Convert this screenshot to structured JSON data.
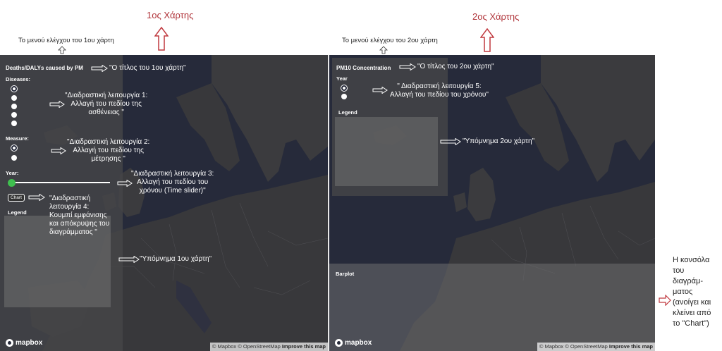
{
  "top": {
    "map1_heading": "1ος Χάρτης",
    "map2_heading": "2ος Χάρτης",
    "map1_menu_note": "Το μενού ελέγχου του 1ου χάρτη",
    "map2_menu_note": "Το μενού ελέγχου του 2ου χάρτη"
  },
  "map1": {
    "title": "Deaths/DALYs caused by PM",
    "diseases_label": "Diseases:",
    "measure_label": "Measure:",
    "year_label": "Year:",
    "chart_button": "Chart",
    "legend_label": "Legend",
    "year_slider_fraction": 0.0,
    "annotations": {
      "title_note": "\"Ο τίτλος του 1ου χάρτη\"",
      "feature1": "\"Διαδραστική λειτουργία 1:\nΑλλαγή του πεδίου της\nασθένειας \"",
      "feature2": "\"Διαδραστική λειτουργία 2:\nΑλλαγή του πεδίου της\nμέτρησης \"",
      "feature3": "\"Διαδραστική λειτουργία 3:\nΑλλαγή του πεδίου του\nχρόνου (Time slider)\"",
      "feature4": "\"Διαδραστική\nλειτουργία 4:\nΚουμπί εμφάνισης\nκαι απόκρυψης του\nδιαγράμματος \"",
      "legend_note": "\"Υπόμνημα 1ου χάρτη\""
    }
  },
  "map2": {
    "title": "PM10 Concentration",
    "year_label": "Year",
    "legend_label": "Legend",
    "barplot_label": "Barplot",
    "annotations": {
      "title_note": "\"Ο τίτλος του 2ου χάρτη\"",
      "feature5": "\" Διαδραστική λειτουργία 5:\nΑλλαγή του πεδίου του χρόνου\"",
      "legend_note": "\"Υπόμνημα 2ου χάρτη\""
    }
  },
  "side_note": "Η κονσόλα του διαγράμ-ματος (ανοίγει και κλείνει από το \"Chart\")",
  "footer": {
    "logo": "mapbox",
    "attribution_mapbox": "© Mapbox",
    "attribution_osm": "© OpenStreetMap",
    "improve": "Improve this map"
  },
  "colors": {
    "ocean": "#262a3a",
    "land": "#3a3a3c",
    "accent_red": "#b0343a",
    "slider_thumb": "#3fbf4f"
  }
}
